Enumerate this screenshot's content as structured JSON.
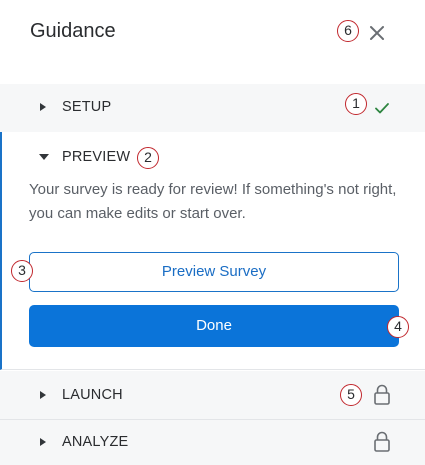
{
  "header": {
    "title": "Guidance",
    "close_badge": "6"
  },
  "sections": {
    "setup": {
      "label": "SETUP",
      "badge": "1",
      "status": "complete"
    },
    "preview": {
      "label": "PREVIEW",
      "badge": "2",
      "description": "Your survey is ready for review! If something's not right, you can make edits or start over.",
      "preview_button": "Preview Survey",
      "preview_badge": "3",
      "done_button": "Done",
      "done_badge": "4"
    },
    "launch": {
      "label": "LAUNCH",
      "badge": "5",
      "status": "locked"
    },
    "analyze": {
      "label": "ANALYZE",
      "status": "locked"
    }
  },
  "colors": {
    "accent": "#0b74d9",
    "accent_border": "#1a73c8",
    "check": "#2e8540",
    "badge_ring": "#c1272d",
    "row_bg": "#f6f7f8"
  },
  "icons": {
    "close": "close-icon",
    "check": "checkmark-icon",
    "lock": "lock-icon",
    "caret_right": "caret-right-icon",
    "caret_down": "caret-down-icon"
  }
}
